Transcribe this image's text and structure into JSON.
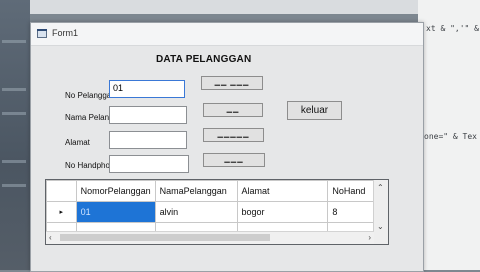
{
  "window": {
    "title": "Form1"
  },
  "heading": "DATA PELANGGAN",
  "fields": [
    {
      "label": "No Pelanggan",
      "value": "01"
    },
    {
      "label": "Nama Pelanggan",
      "value": ""
    },
    {
      "label": "Alamat",
      "value": ""
    },
    {
      "label": "No Handphone",
      "value": ""
    }
  ],
  "buttons": {
    "b1": "▁▁ ▁▁▁",
    "b2": "▁▁",
    "b3": "▁▁▁▁▁",
    "b4": "▁▁▁",
    "keluar": "keluar"
  },
  "grid": {
    "columns": [
      "NomorPelanggan",
      "NamaPelanggan",
      "Alamat",
      "NoHand"
    ],
    "rows": [
      {
        "indicator": "▸",
        "cells": [
          "01",
          "alvin",
          "bogor",
          "8"
        ]
      }
    ]
  },
  "code_fragments": {
    "line1": "xt & \",'\" &",
    "line2": "one=\" & Tex"
  },
  "icons": {
    "app": "form-app-icon",
    "scroll_up": "chevron-up-icon",
    "scroll_down": "chevron-down-icon",
    "scroll_left": "chevron-left-icon",
    "scroll_right": "chevron-right-icon"
  }
}
